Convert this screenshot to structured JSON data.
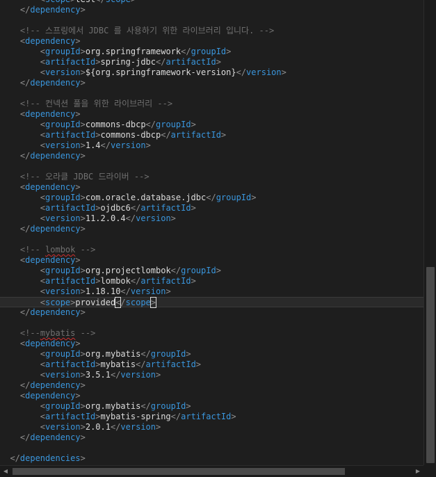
{
  "editor": {
    "lines": [
      {
        "indent": "        ",
        "segs": [
          [
            "b",
            "<"
          ],
          [
            "t",
            "scope"
          ],
          [
            "b",
            ">"
          ],
          [
            "x",
            "test"
          ],
          [
            "b",
            "</"
          ],
          [
            "t",
            "scope"
          ],
          [
            "b",
            ">"
          ]
        ]
      },
      {
        "indent": "    ",
        "segs": [
          [
            "b",
            "</"
          ],
          [
            "t",
            "dependency"
          ],
          [
            "b",
            ">"
          ]
        ]
      },
      {
        "indent": "",
        "segs": []
      },
      {
        "indent": "    ",
        "segs": [
          [
            "c",
            "<!-- 스프링에서 JDBC 를 사용하기 위한 라이브러리 입니다. -->"
          ]
        ]
      },
      {
        "indent": "    ",
        "segs": [
          [
            "b",
            "<"
          ],
          [
            "t",
            "dependency"
          ],
          [
            "b",
            ">"
          ]
        ]
      },
      {
        "indent": "        ",
        "segs": [
          [
            "b",
            "<"
          ],
          [
            "t",
            "groupId"
          ],
          [
            "b",
            ">"
          ],
          [
            "x",
            "org.springframework"
          ],
          [
            "b",
            "</"
          ],
          [
            "t",
            "groupId"
          ],
          [
            "b",
            ">"
          ]
        ]
      },
      {
        "indent": "        ",
        "segs": [
          [
            "b",
            "<"
          ],
          [
            "t",
            "artifactId"
          ],
          [
            "b",
            ">"
          ],
          [
            "x",
            "spring-jdbc"
          ],
          [
            "b",
            "</"
          ],
          [
            "t",
            "artifactId"
          ],
          [
            "b",
            ">"
          ]
        ]
      },
      {
        "indent": "        ",
        "segs": [
          [
            "b",
            "<"
          ],
          [
            "t",
            "version"
          ],
          [
            "b",
            ">"
          ],
          [
            "x",
            "${org.springframework-version}"
          ],
          [
            "b",
            "</"
          ],
          [
            "t",
            "version"
          ],
          [
            "b",
            ">"
          ]
        ]
      },
      {
        "indent": "    ",
        "segs": [
          [
            "b",
            "</"
          ],
          [
            "t",
            "dependency"
          ],
          [
            "b",
            ">"
          ]
        ]
      },
      {
        "indent": "",
        "segs": []
      },
      {
        "indent": "    ",
        "segs": [
          [
            "c",
            "<!-- 컨넥션 풀을 위한 라이브러리 -->"
          ]
        ]
      },
      {
        "indent": "    ",
        "segs": [
          [
            "b",
            "<"
          ],
          [
            "t",
            "dependency"
          ],
          [
            "b",
            ">"
          ]
        ]
      },
      {
        "indent": "        ",
        "segs": [
          [
            "b",
            "<"
          ],
          [
            "t",
            "groupId"
          ],
          [
            "b",
            ">"
          ],
          [
            "x",
            "commons-dbcp"
          ],
          [
            "b",
            "</"
          ],
          [
            "t",
            "groupId"
          ],
          [
            "b",
            ">"
          ]
        ]
      },
      {
        "indent": "        ",
        "segs": [
          [
            "b",
            "<"
          ],
          [
            "t",
            "artifactId"
          ],
          [
            "b",
            ">"
          ],
          [
            "x",
            "commons-dbcp"
          ],
          [
            "b",
            "</"
          ],
          [
            "t",
            "artifactId"
          ],
          [
            "b",
            ">"
          ]
        ]
      },
      {
        "indent": "        ",
        "segs": [
          [
            "b",
            "<"
          ],
          [
            "t",
            "version"
          ],
          [
            "b",
            ">"
          ],
          [
            "x",
            "1.4"
          ],
          [
            "b",
            "</"
          ],
          [
            "t",
            "version"
          ],
          [
            "b",
            ">"
          ]
        ]
      },
      {
        "indent": "    ",
        "segs": [
          [
            "b",
            "</"
          ],
          [
            "t",
            "dependency"
          ],
          [
            "b",
            ">"
          ]
        ]
      },
      {
        "indent": "",
        "segs": []
      },
      {
        "indent": "    ",
        "segs": [
          [
            "c",
            "<!-- 오라클 JDBC 드라이버 -->"
          ]
        ]
      },
      {
        "indent": "    ",
        "segs": [
          [
            "b",
            "<"
          ],
          [
            "t",
            "dependency"
          ],
          [
            "b",
            ">"
          ]
        ]
      },
      {
        "indent": "        ",
        "segs": [
          [
            "b",
            "<"
          ],
          [
            "t",
            "groupId"
          ],
          [
            "b",
            ">"
          ],
          [
            "x",
            "com.oracle.database.jdbc"
          ],
          [
            "b",
            "</"
          ],
          [
            "t",
            "groupId"
          ],
          [
            "b",
            ">"
          ]
        ]
      },
      {
        "indent": "        ",
        "segs": [
          [
            "b",
            "<"
          ],
          [
            "t",
            "artifactId"
          ],
          [
            "b",
            ">"
          ],
          [
            "x",
            "ojdbc6"
          ],
          [
            "b",
            "</"
          ],
          [
            "t",
            "artifactId"
          ],
          [
            "b",
            ">"
          ]
        ]
      },
      {
        "indent": "        ",
        "segs": [
          [
            "b",
            "<"
          ],
          [
            "t",
            "version"
          ],
          [
            "b",
            ">"
          ],
          [
            "x",
            "11.2.0.4"
          ],
          [
            "b",
            "</"
          ],
          [
            "t",
            "version"
          ],
          [
            "b",
            ">"
          ]
        ]
      },
      {
        "indent": "    ",
        "segs": [
          [
            "b",
            "</"
          ],
          [
            "t",
            "dependency"
          ],
          [
            "b",
            ">"
          ]
        ]
      },
      {
        "indent": "",
        "segs": []
      },
      {
        "indent": "    ",
        "segs": [
          [
            "c",
            "<!-- "
          ],
          [
            "cs",
            "lombok"
          ],
          [
            "c",
            " -->"
          ]
        ]
      },
      {
        "indent": "    ",
        "segs": [
          [
            "b",
            "<"
          ],
          [
            "t",
            "dependency"
          ],
          [
            "b",
            ">"
          ]
        ]
      },
      {
        "indent": "        ",
        "segs": [
          [
            "b",
            "<"
          ],
          [
            "t",
            "groupId"
          ],
          [
            "b",
            ">"
          ],
          [
            "x",
            "org.projectlombok"
          ],
          [
            "b",
            "</"
          ],
          [
            "t",
            "groupId"
          ],
          [
            "b",
            ">"
          ]
        ]
      },
      {
        "indent": "        ",
        "segs": [
          [
            "b",
            "<"
          ],
          [
            "t",
            "artifactId"
          ],
          [
            "b",
            ">"
          ],
          [
            "x",
            "lombok"
          ],
          [
            "b",
            "</"
          ],
          [
            "t",
            "artifactId"
          ],
          [
            "b",
            ">"
          ]
        ]
      },
      {
        "indent": "        ",
        "segs": [
          [
            "b",
            "<"
          ],
          [
            "t",
            "version"
          ],
          [
            "b",
            ">"
          ],
          [
            "x",
            "1.18.10"
          ],
          [
            "b",
            "</"
          ],
          [
            "t",
            "version"
          ],
          [
            "b",
            ">"
          ]
        ]
      },
      {
        "indent": "        ",
        "current": true,
        "segs": [
          [
            "b",
            "<"
          ],
          [
            "t",
            "scope"
          ],
          [
            "b",
            ">"
          ],
          [
            "x",
            "provided"
          ],
          [
            "bx",
            "<"
          ],
          [
            "b",
            "/"
          ],
          [
            "t",
            "scope"
          ],
          [
            "bx",
            ">"
          ],
          [
            "caret",
            ""
          ]
        ]
      },
      {
        "indent": "    ",
        "segs": [
          [
            "b",
            "</"
          ],
          [
            "t",
            "dependency"
          ],
          [
            "b",
            ">"
          ]
        ]
      },
      {
        "indent": "",
        "segs": []
      },
      {
        "indent": "    ",
        "segs": [
          [
            "c",
            "<!--"
          ],
          [
            "cs",
            "mybatis"
          ],
          [
            "c",
            " -->"
          ]
        ]
      },
      {
        "indent": "    ",
        "segs": [
          [
            "b",
            "<"
          ],
          [
            "t",
            "dependency"
          ],
          [
            "b",
            ">"
          ]
        ]
      },
      {
        "indent": "        ",
        "segs": [
          [
            "b",
            "<"
          ],
          [
            "t",
            "groupId"
          ],
          [
            "b",
            ">"
          ],
          [
            "x",
            "org.mybatis"
          ],
          [
            "b",
            "</"
          ],
          [
            "t",
            "groupId"
          ],
          [
            "b",
            ">"
          ]
        ]
      },
      {
        "indent": "        ",
        "segs": [
          [
            "b",
            "<"
          ],
          [
            "t",
            "artifactId"
          ],
          [
            "b",
            ">"
          ],
          [
            "x",
            "mybatis"
          ],
          [
            "b",
            "</"
          ],
          [
            "t",
            "artifactId"
          ],
          [
            "b",
            ">"
          ]
        ]
      },
      {
        "indent": "        ",
        "segs": [
          [
            "b",
            "<"
          ],
          [
            "t",
            "version"
          ],
          [
            "b",
            ">"
          ],
          [
            "x",
            "3.5.1"
          ],
          [
            "b",
            "</"
          ],
          [
            "t",
            "version"
          ],
          [
            "b",
            ">"
          ]
        ]
      },
      {
        "indent": "    ",
        "segs": [
          [
            "b",
            "</"
          ],
          [
            "t",
            "dependency"
          ],
          [
            "b",
            ">"
          ]
        ]
      },
      {
        "indent": "    ",
        "segs": [
          [
            "b",
            "<"
          ],
          [
            "t",
            "dependency"
          ],
          [
            "b",
            ">"
          ]
        ]
      },
      {
        "indent": "        ",
        "segs": [
          [
            "b",
            "<"
          ],
          [
            "t",
            "groupId"
          ],
          [
            "b",
            ">"
          ],
          [
            "x",
            "org.mybatis"
          ],
          [
            "b",
            "</"
          ],
          [
            "t",
            "groupId"
          ],
          [
            "b",
            ">"
          ]
        ]
      },
      {
        "indent": "        ",
        "segs": [
          [
            "b",
            "<"
          ],
          [
            "t",
            "artifactId"
          ],
          [
            "b",
            ">"
          ],
          [
            "x",
            "mybatis-spring"
          ],
          [
            "b",
            "</"
          ],
          [
            "t",
            "artifactId"
          ],
          [
            "b",
            ">"
          ]
        ]
      },
      {
        "indent": "        ",
        "segs": [
          [
            "b",
            "<"
          ],
          [
            "t",
            "version"
          ],
          [
            "b",
            ">"
          ],
          [
            "x",
            "2.0.1"
          ],
          [
            "b",
            "</"
          ],
          [
            "t",
            "version"
          ],
          [
            "b",
            ">"
          ]
        ]
      },
      {
        "indent": "    ",
        "segs": [
          [
            "b",
            "</"
          ],
          [
            "t",
            "dependency"
          ],
          [
            "b",
            ">"
          ]
        ]
      },
      {
        "indent": "",
        "segs": []
      },
      {
        "indent": "  ",
        "segs": [
          [
            "b",
            "</"
          ],
          [
            "t",
            "dependencies"
          ],
          [
            "b",
            ">"
          ]
        ]
      }
    ]
  },
  "scrollbars": {
    "left_arrow": "◀",
    "right_arrow": "▶"
  },
  "colors": {
    "background": "#1e1e1e",
    "tag": "#3a96dd",
    "bracket": "#8f8f8f",
    "text": "#dcdcdc",
    "comment": "#707070"
  }
}
